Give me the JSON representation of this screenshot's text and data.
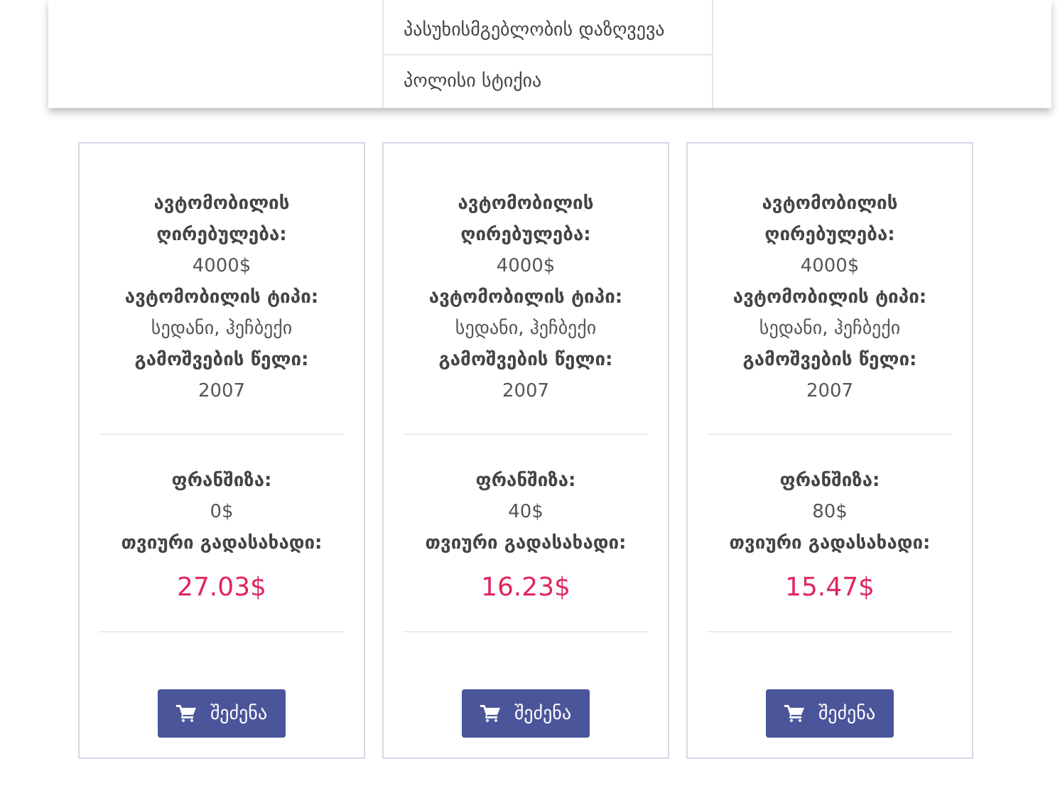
{
  "menu": {
    "items": [
      "პასუხისმგებლობის დაზღვევა",
      "პოლისი სტიქია"
    ]
  },
  "plans": [
    {
      "fields": [
        {
          "label": "ავტომობილის ღირებულება:",
          "value": "4000$"
        },
        {
          "label": "ავტომობილის ტიპი:",
          "value": "სედანი, ჰეჩბექი"
        },
        {
          "label": "გამოშვების წელი:",
          "value": "2007"
        }
      ],
      "deductible": {
        "label": "ფრანშიზა:",
        "value": "0$"
      },
      "monthly": {
        "label": "თვიური გადასახადი:",
        "value": "27.03$"
      },
      "button": "შეძენა"
    },
    {
      "fields": [
        {
          "label": "ავტომობილის ღირებულება:",
          "value": "4000$"
        },
        {
          "label": "ავტომობილის ტიპი:",
          "value": "სედანი, ჰეჩბექი"
        },
        {
          "label": "გამოშვების წელი:",
          "value": "2007"
        }
      ],
      "deductible": {
        "label": "ფრანშიზა:",
        "value": "40$"
      },
      "monthly": {
        "label": "თვიური გადასახადი:",
        "value": "16.23$"
      },
      "button": "შეძენა"
    },
    {
      "fields": [
        {
          "label": "ავტომობილის ღირებულება:",
          "value": "4000$"
        },
        {
          "label": "ავტომობილის ტიპი:",
          "value": "სედანი, ჰეჩბექი"
        },
        {
          "label": "გამოშვების წელი:",
          "value": "2007"
        }
      ],
      "deductible": {
        "label": "ფრანშიზა:",
        "value": "80$"
      },
      "monthly": {
        "label": "თვიური გადასახადი:",
        "value": "15.47$"
      },
      "button": "შეძენა"
    }
  ]
}
